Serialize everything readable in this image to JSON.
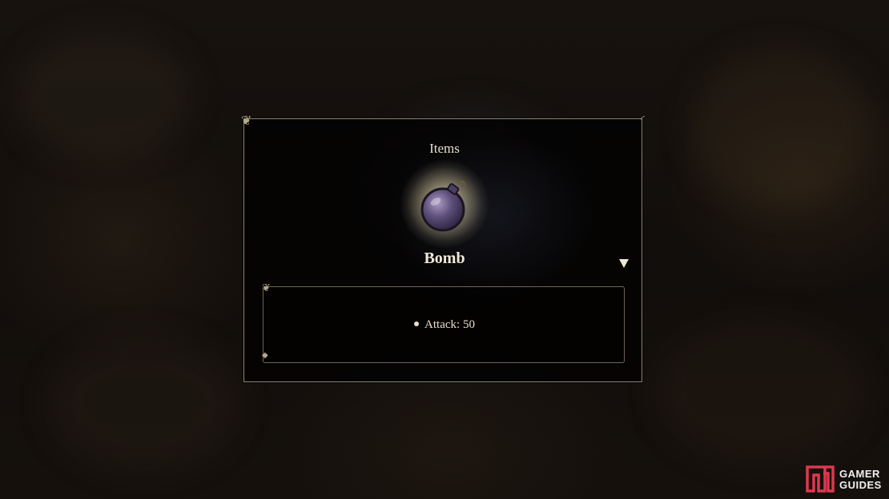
{
  "dialog": {
    "category": "Items",
    "item_name": "Bomb",
    "stats": [
      "Attack: 50"
    ],
    "item_icon": "bomb-icon",
    "next_indicator_icon": "down-arrow-icon"
  },
  "watermark": {
    "line1": "GAMER",
    "line2": "GUIDES"
  },
  "colors": {
    "frame_border": "#8f8572",
    "text": "#e6dfcf",
    "watermark_logo": "#e2364f"
  }
}
